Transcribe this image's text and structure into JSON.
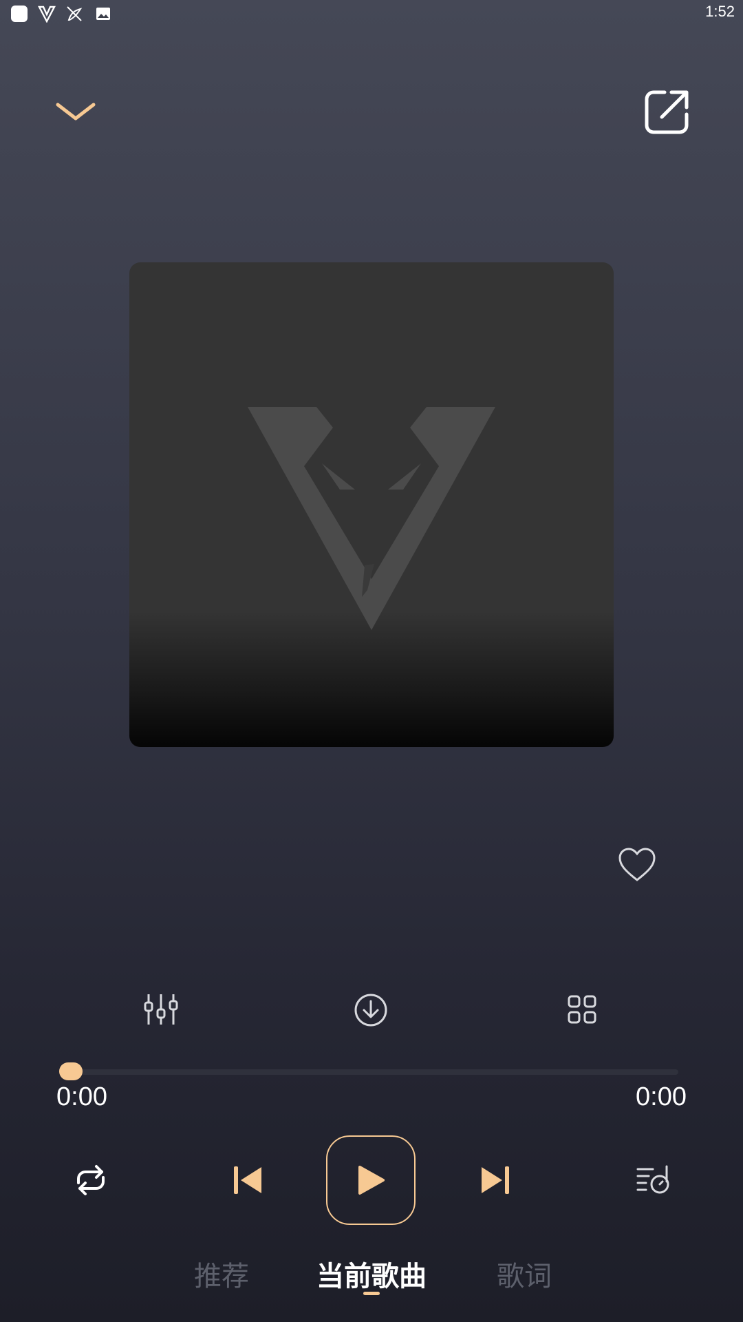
{
  "status_bar": {
    "time": "1:52",
    "icons": [
      "app-square-icon",
      "v-logo-icon",
      "bird-off-icon",
      "image-icon"
    ]
  },
  "header": {
    "collapse_icon": "chevron-down-icon",
    "share_icon": "share-external-icon"
  },
  "album_art": {
    "icon": "viper-v-logo-icon"
  },
  "actions": {
    "favorite_icon": "heart-outline-icon",
    "equalizer_icon": "equalizer-sliders-icon",
    "download_icon": "download-circle-icon",
    "more_icon": "grid-four-icon"
  },
  "progress": {
    "current_time": "0:00",
    "total_time": "0:00",
    "fraction": 0.0
  },
  "controls": {
    "repeat_icon": "repeat-icon",
    "prev_icon": "skip-previous-icon",
    "play_icon": "play-icon",
    "next_icon": "skip-next-icon",
    "queue_icon": "playlist-music-icon"
  },
  "tabs": [
    {
      "label": "推荐",
      "active": false
    },
    {
      "label": "当前歌曲",
      "active": true
    },
    {
      "label": "歌词",
      "active": false
    }
  ],
  "colors": {
    "accent": "#f7c993",
    "icon": "#d8d9de",
    "inactive_tab": "#5d606c"
  }
}
